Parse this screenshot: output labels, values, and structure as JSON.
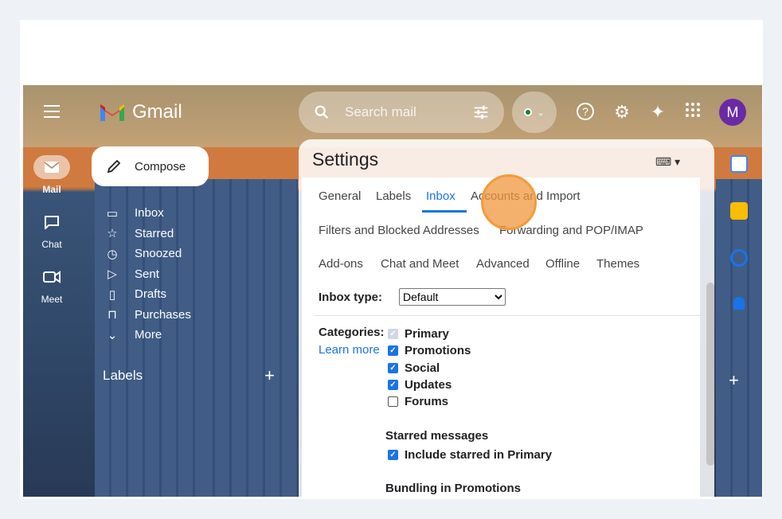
{
  "app": {
    "name": "Gmail"
  },
  "search": {
    "placeholder": "Search mail"
  },
  "profile": {
    "initial": "M",
    "color": "#6a2aa5"
  },
  "left_rail": [
    {
      "label": "Mail",
      "icon": "mail-icon",
      "active": true
    },
    {
      "label": "Chat",
      "icon": "chat-icon",
      "active": false
    },
    {
      "label": "Meet",
      "icon": "video-icon",
      "active": false
    }
  ],
  "compose": {
    "label": "Compose"
  },
  "nav": [
    {
      "label": "Inbox",
      "icon": "inbox-icon"
    },
    {
      "label": "Starred",
      "icon": "star-icon"
    },
    {
      "label": "Snoozed",
      "icon": "clock-icon"
    },
    {
      "label": "Sent",
      "icon": "send-icon"
    },
    {
      "label": "Drafts",
      "icon": "draft-icon"
    },
    {
      "label": "Purchases",
      "icon": "bag-icon"
    },
    {
      "label": "More",
      "icon": "chevron-down-icon"
    }
  ],
  "labels": {
    "heading": "Labels"
  },
  "settings": {
    "title": "Settings",
    "tabs_row1": [
      "General",
      "Labels",
      "Inbox",
      "Accounts and Import"
    ],
    "tabs_row2": [
      "Filters and Blocked Addresses",
      "Forwarding and POP/IMAP"
    ],
    "tabs_row3": [
      "Add-ons",
      "Chat and Meet",
      "Advanced",
      "Offline",
      "Themes"
    ],
    "active_tab": "Inbox",
    "inbox_type_label": "Inbox type:",
    "inbox_type_value": "Default",
    "categories_label": "Categories:",
    "learn_more": "Learn more",
    "categories": [
      {
        "label": "Primary",
        "state": "disabled-checked"
      },
      {
        "label": "Promotions",
        "state": "checked"
      },
      {
        "label": "Social",
        "state": "checked"
      },
      {
        "label": "Updates",
        "state": "checked"
      },
      {
        "label": "Forums",
        "state": "unchecked"
      }
    ],
    "starred_heading": "Starred messages",
    "starred_option": "Include starred in Primary",
    "bundling_heading": "Bundling in Promotions"
  },
  "colors": {
    "accent": "#1a73e8",
    "cursor": "#f39a3c"
  }
}
